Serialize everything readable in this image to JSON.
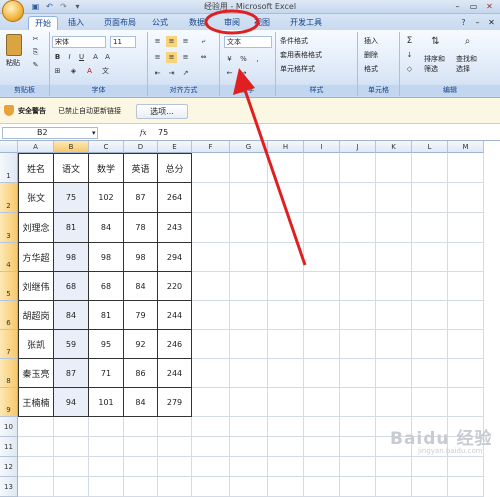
{
  "window": {
    "title": "经验用 - Microsoft Excel"
  },
  "tabs": [
    "开始",
    "插入",
    "页面布局",
    "公式",
    "数据",
    "审阅",
    "视图",
    "开发工具"
  ],
  "ribbon": {
    "paste_label": "粘贴",
    "font_name": "宋体",
    "font_size": "11",
    "number_format": "文本",
    "styles": [
      "条件格式",
      "套用表格格式",
      "单元格样式"
    ],
    "cells": [
      "插入",
      "删除",
      "格式"
    ],
    "edit": [
      "排序和筛选",
      "查找和选择"
    ],
    "groups": [
      "剪贴板",
      "字体",
      "对齐方式",
      "数字",
      "样式",
      "单元格",
      "编辑"
    ]
  },
  "security": {
    "title": "安全警告",
    "message": "已禁止自动更新链接",
    "options_button": "选项..."
  },
  "formula_bar": {
    "name_box": "B2",
    "fx": "fx",
    "value": "75"
  },
  "sheet": {
    "columns": [
      "A",
      "B",
      "C",
      "D",
      "E",
      "F",
      "G",
      "H",
      "I",
      "J",
      "K",
      "L",
      "M"
    ],
    "rows": [
      "1",
      "2",
      "3",
      "4",
      "5",
      "6",
      "7",
      "8",
      "9",
      "10",
      "11",
      "12",
      "13"
    ],
    "table": [
      [
        "姓名",
        "语文",
        "数学",
        "英语",
        "总分"
      ],
      [
        "张文",
        "75",
        "102",
        "87",
        "264"
      ],
      [
        "刘理念",
        "81",
        "84",
        "78",
        "243"
      ],
      [
        "方华超",
        "98",
        "98",
        "98",
        "294"
      ],
      [
        "刘继伟",
        "68",
        "68",
        "84",
        "220"
      ],
      [
        "胡超岗",
        "84",
        "81",
        "79",
        "244"
      ],
      [
        "张凯",
        "59",
        "95",
        "92",
        "246"
      ],
      [
        "秦玉亮",
        "87",
        "71",
        "86",
        "244"
      ],
      [
        "王楠楠",
        "94",
        "101",
        "84",
        "279"
      ]
    ]
  },
  "watermark": "Baidu 经验",
  "watermark_sub": "jingyan.baidu.com",
  "colors": {
    "annotation": "#e02020",
    "accent": "#15428b"
  }
}
